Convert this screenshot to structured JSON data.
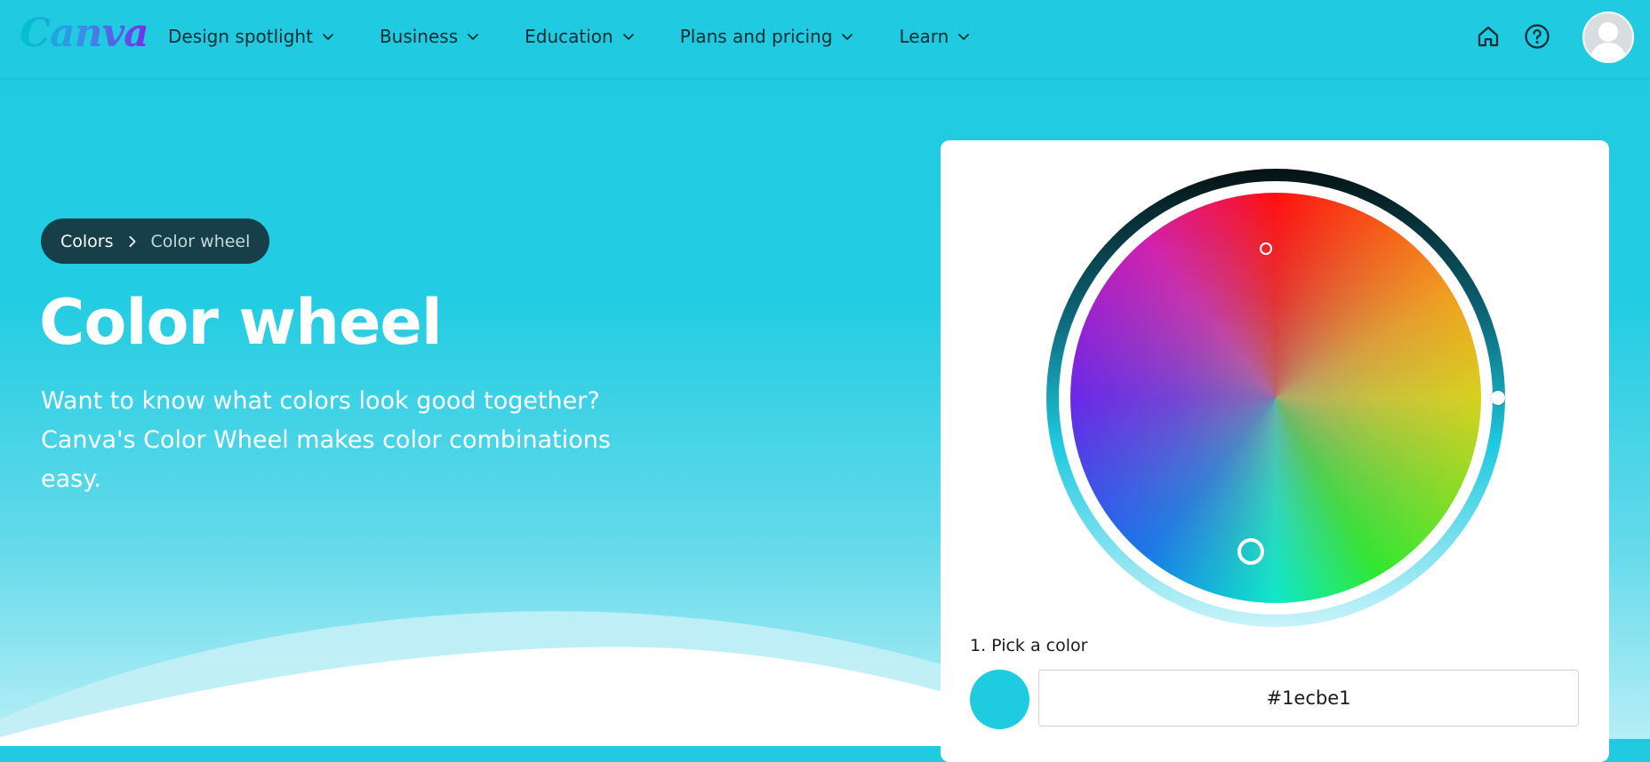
{
  "header": {
    "logo": "Canva",
    "nav": [
      {
        "label": "Design spotlight"
      },
      {
        "label": "Business"
      },
      {
        "label": "Education"
      },
      {
        "label": "Plans and pricing"
      },
      {
        "label": "Learn"
      }
    ],
    "icons": [
      "home-icon",
      "help-icon",
      "avatar"
    ]
  },
  "breadcrumb": {
    "items": [
      "Colors",
      "Color wheel"
    ]
  },
  "hero": {
    "title": "Color wheel",
    "description": "Want to know what colors look good together? Canva's Color Wheel makes color combinations easy."
  },
  "picker": {
    "step_label": "1. Pick a color",
    "hex_value": "#1ecbe1",
    "swatch_color": "#1ecbe1"
  },
  "colors": {
    "page_bg": "#20cbe2",
    "breadcrumb_bg": "#173f49",
    "card_bg": "#ffffff"
  }
}
